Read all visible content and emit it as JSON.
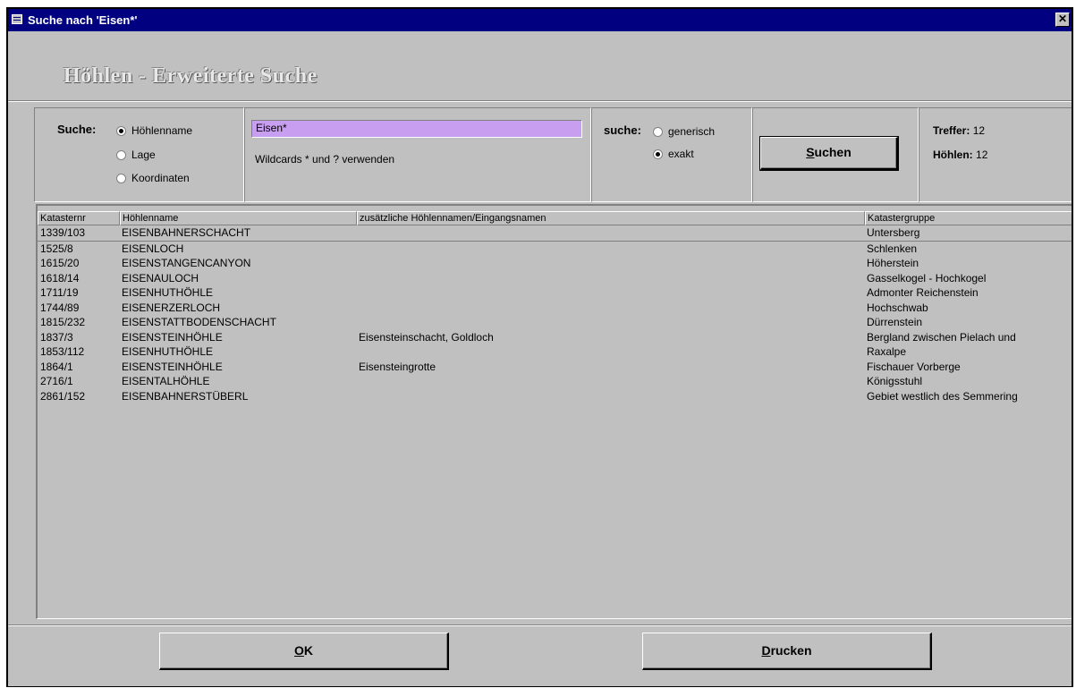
{
  "window": {
    "title": "Suche nach 'Eisen*'",
    "close_glyph": "✕"
  },
  "heading": "Höhlen - Erweiterte Suche",
  "search": {
    "label": "Suche:",
    "options": [
      {
        "label": "Höhlenname",
        "selected": true
      },
      {
        "label": "Lage",
        "selected": false
      },
      {
        "label": "Koordinaten",
        "selected": false
      }
    ],
    "input_value": "Eisen*",
    "hint": "Wildcards * und ? verwenden"
  },
  "mode": {
    "label": "suche:",
    "options": [
      {
        "label": "generisch",
        "selected": false
      },
      {
        "label": "exakt",
        "selected": true
      }
    ]
  },
  "search_button": {
    "accel": "S",
    "rest": "uchen"
  },
  "stats": {
    "treffer_label": "Treffer:",
    "treffer_value": "12",
    "hoehlen_label": "Höhlen:",
    "hoehlen_value": "12"
  },
  "table": {
    "columns": [
      "Katasternr",
      "Höhlenname",
      "zusätzliche Höhlennamen/Eingangsnamen",
      "Katastergruppe"
    ],
    "rows": [
      [
        "1339/103",
        "EISENBAHNERSCHACHT",
        "",
        "Untersberg"
      ],
      [
        "1525/8",
        "EISENLOCH",
        "",
        "Schlenken"
      ],
      [
        "1615/20",
        "EISENSTANGENCANYON",
        "",
        "Höherstein"
      ],
      [
        "1618/14",
        "EISENAULOCH",
        "",
        "Gasselkogel - Hochkogel"
      ],
      [
        "1711/19",
        "EISENHUTHÖHLE",
        "",
        "Admonter Reichenstein"
      ],
      [
        "1744/89",
        "EISENERZERLOCH",
        "",
        "Hochschwab"
      ],
      [
        "1815/232",
        "EISENSTATTBODENSCHACHT",
        "",
        "Dürrenstein"
      ],
      [
        "1837/3",
        "EISENSTEINHÖHLE",
        "Eisensteinschacht, Goldloch",
        "Bergland zwischen Pielach und"
      ],
      [
        "1853/112",
        "EISENHUTHÖHLE",
        "",
        "Raxalpe"
      ],
      [
        "1864/1",
        "EISENSTEINHÖHLE",
        "Eisensteingrotte",
        "Fischauer Vorberge"
      ],
      [
        "2716/1",
        "EISENTALHÖHLE",
        "",
        "Königsstuhl"
      ],
      [
        "2861/152",
        "EISENBAHNERSTÜBERL",
        "",
        "Gebiet westlich des Semmering"
      ]
    ]
  },
  "buttons": {
    "ok": {
      "accel": "O",
      "rest": "K"
    },
    "print": {
      "accel": "D",
      "rest": "rucken"
    }
  }
}
